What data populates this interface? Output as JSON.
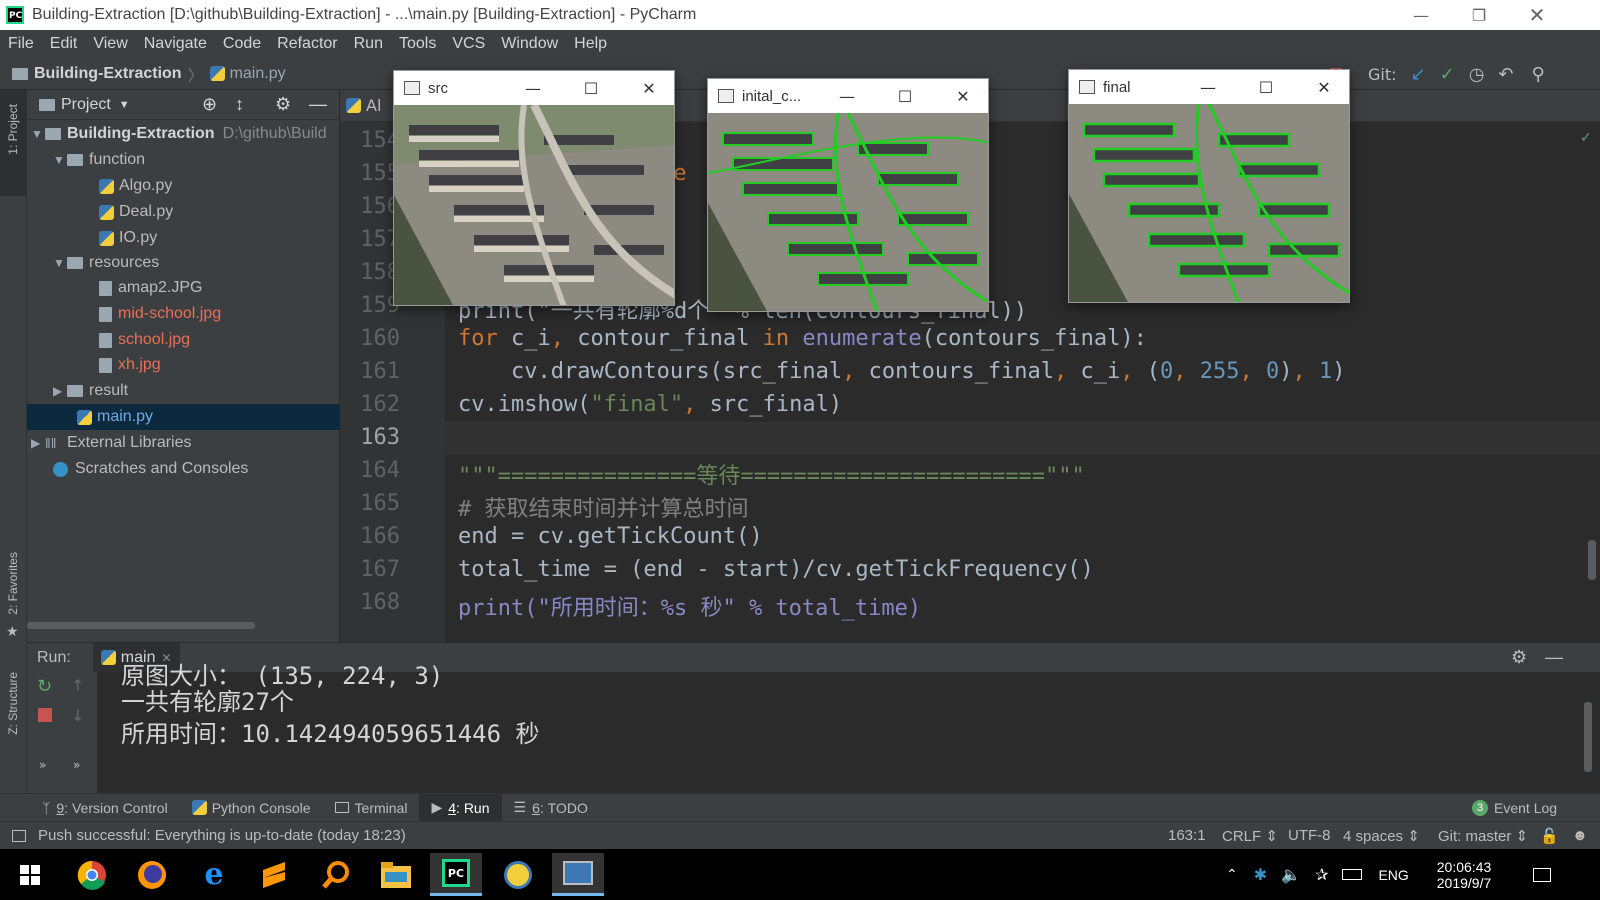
{
  "window": {
    "title": "Building-Extraction [D:\\github\\Building-Extraction] - ...\\main.py [Building-Extraction] - PyCharm",
    "app_icon_text": "PC"
  },
  "menu": [
    "File",
    "Edit",
    "View",
    "Navigate",
    "Code",
    "Refactor",
    "Run",
    "Tools",
    "VCS",
    "Window",
    "Help"
  ],
  "breadcrumb": {
    "project": "Building-Extraction",
    "file": "main.py"
  },
  "toolbar": {
    "git_label": "Git:"
  },
  "project_panel": {
    "title": "Project",
    "tree": [
      {
        "label": "Building-Extraction",
        "extra": "D:\\github\\Build",
        "type": "folder",
        "expanded": true,
        "depth": 0
      },
      {
        "label": "function",
        "type": "folder",
        "expanded": true,
        "depth": 1
      },
      {
        "label": "Algo.py",
        "type": "py",
        "depth": 2
      },
      {
        "label": "Deal.py",
        "type": "py",
        "depth": 2
      },
      {
        "label": "IO.py",
        "type": "py",
        "depth": 2
      },
      {
        "label": "resources",
        "type": "folder",
        "expanded": true,
        "depth": 1
      },
      {
        "label": "amap2.JPG",
        "type": "image",
        "depth": 2
      },
      {
        "label": "mid-school.jpg",
        "type": "image",
        "status": "untracked",
        "depth": 2
      },
      {
        "label": "school.jpg",
        "type": "image",
        "status": "untracked",
        "depth": 2
      },
      {
        "label": "xh.jpg",
        "type": "image",
        "status": "untracked",
        "depth": 2
      },
      {
        "label": "result",
        "type": "folder",
        "expanded": false,
        "depth": 1
      },
      {
        "label": "main.py",
        "type": "py",
        "selected": true,
        "depth": 1
      },
      {
        "label": "External Libraries",
        "type": "lib",
        "expanded": false,
        "depth": 0
      },
      {
        "label": "Scratches and Consoles",
        "type": "scratch",
        "depth": 0
      }
    ]
  },
  "editor": {
    "tab_partial": "Al",
    "current_line": 163,
    "line_numbers": [
      "154",
      "155",
      "156",
      "157",
      "158",
      "159",
      "160",
      "161",
      "162",
      "163",
      "164",
      "165",
      "166",
      "167",
      "168"
    ],
    "partial_155": "ue",
    "line_159_partial": "print(\"一共有轮廓%d个\" % len(contours_final))",
    "line_160": [
      "for",
      " c_i",
      ", ",
      "contour_final ",
      "in",
      " ",
      "enumerate",
      "(contours_final):"
    ],
    "line_161": [
      "    cv.drawContours(src_final",
      ", ",
      "contours_final",
      ", ",
      "c_i",
      ", ",
      "(",
      "0",
      ", ",
      "255",
      ", ",
      "0",
      ")",
      ", ",
      "1",
      ")"
    ],
    "line_162": [
      "cv.imshow(",
      "\"final\"",
      ", ",
      "src_final)"
    ],
    "line_164": "\"\"\"===============等待=======================\"\"\"",
    "line_165": "# 获取结束时间并计算总时间",
    "line_166": [
      "end",
      " = ",
      "cv.getTickCount()"
    ],
    "line_167": "total_time = (end - start)/cv.getTickFrequency()",
    "line_168_partial": "print(\"所用时间：%s 秒\" % total_time)"
  },
  "cv_windows": [
    {
      "title": "src"
    },
    {
      "title": "inital_c..."
    },
    {
      "title": "final"
    }
  ],
  "run_panel": {
    "label": "Run:",
    "tab": "main",
    "output": [
      "原图大小： (135, 224, 3)",
      "一共有轮廓27个",
      "所用时间：10.142494059651446 秒"
    ]
  },
  "bottom_tools": [
    {
      "num": "9",
      "label": "Version Control"
    },
    {
      "num": "",
      "label": "Python Console"
    },
    {
      "num": "",
      "label": "Terminal"
    },
    {
      "num": "4",
      "label": "Run",
      "active": true
    },
    {
      "num": "6",
      "label": "TODO"
    }
  ],
  "event_log": {
    "count": "3",
    "label": "Event Log"
  },
  "status": {
    "message": "Push successful: Everything is up-to-date (today 18:23)",
    "position": "163:1",
    "line_sep": "CRLF",
    "encoding": "UTF-8",
    "indent": "4 spaces",
    "git": "Git: master"
  },
  "taskbar": {
    "time": "20:06:43",
    "date": "2019/9/7",
    "lang": "ENG"
  },
  "side_labels": {
    "project": "1: Project",
    "favorites": "2: Favorites",
    "structure": "Z: Structure"
  },
  "colors": {
    "accent": "#21d789",
    "contour": "#22cc22",
    "selection": "#0d293e",
    "stop": "#c75450"
  }
}
